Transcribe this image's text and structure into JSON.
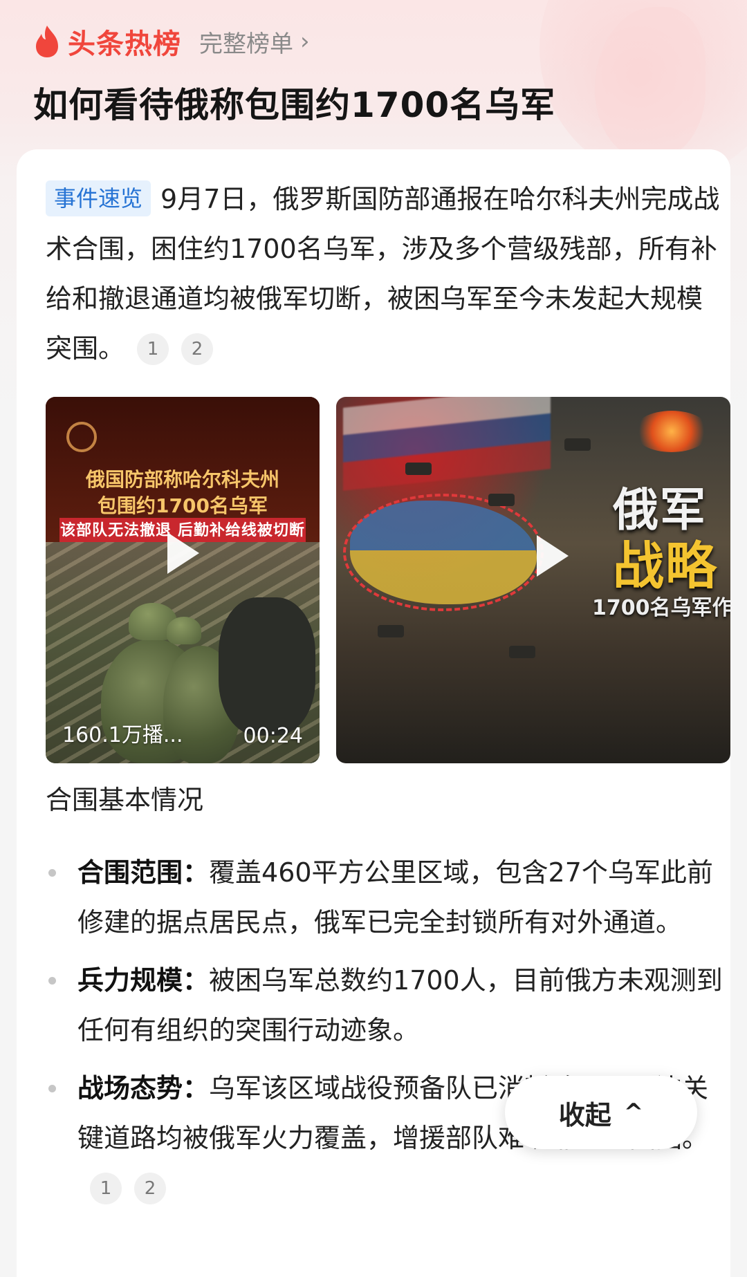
{
  "header": {
    "brand": "头条热榜",
    "full_list": "完整榜单",
    "title": "如何看待俄称包围约1700名乌军"
  },
  "summary": {
    "tag": "事件速览",
    "text": "9月7日，俄罗斯国防部通报在哈尔科夫州完成战术合围，困住约1700名乌军，涉及多个营级残部，所有补给和撤退通道均被俄军切断，被困乌军至今未发起大规模突围。",
    "citations": [
      "1",
      "2"
    ]
  },
  "videos": [
    {
      "title_line1": "俄国防部称哈尔科夫州",
      "title_line2": "包围约1700名乌军",
      "banner": "该部队无法撤退 后勤补给线被切断",
      "views": "160.1万播...",
      "duration": "00:24"
    },
    {
      "title_line1": "俄军",
      "title_line2": "战略",
      "subtitle": "1700名乌军作"
    }
  ],
  "section": {
    "title": "合围基本情况",
    "bullets": [
      {
        "label": "合围范围：",
        "text": "覆盖460平方公里区域，包含27个乌军此前修建的据点居民点，俄军已完全封锁所有对外通道。"
      },
      {
        "label": "兵力规模：",
        "text": "被困乌军总数约1700人，目前俄方未观测到任何有组织的突围行动迹象。"
      },
      {
        "label": "战场态势：",
        "text": "乌军该区域战役预备队已消耗殆尽，周边关键道路均被俄军火力覆盖，增援部队难以靠近包围圈。",
        "citations": [
          "1",
          "2"
        ]
      }
    ]
  },
  "collapse_label": "收起",
  "colors": {
    "brand_red": "#f0463c",
    "tag_bg": "#e6f1fd",
    "tag_text": "#2673d4"
  }
}
